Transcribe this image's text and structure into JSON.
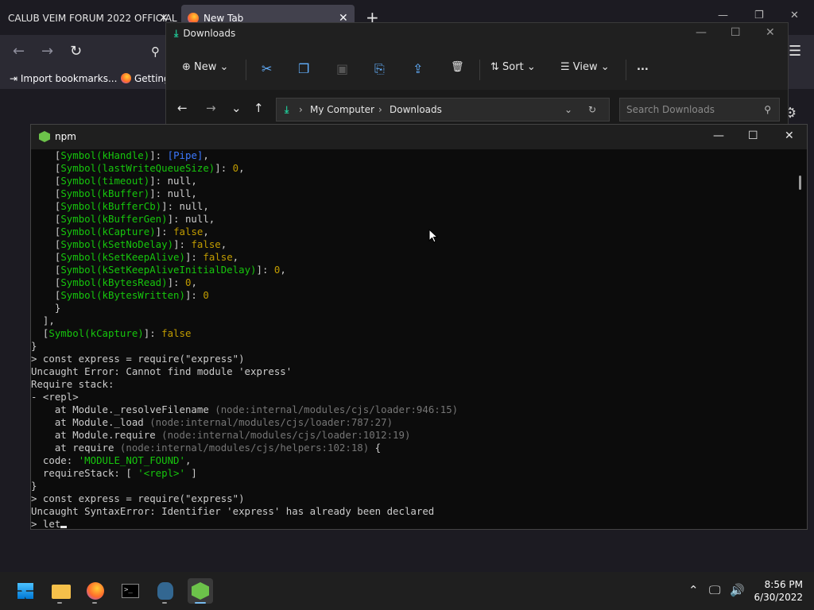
{
  "browser": {
    "tabs": [
      {
        "label": "CALUB VEIM FORUM 2022 OFFICIAL",
        "close": "✕"
      },
      {
        "label": "New Tab",
        "close": "✕"
      }
    ],
    "new_tab": "+",
    "bookmarks": [
      {
        "label": "Import bookmarks...",
        "icon": "import-icon"
      },
      {
        "label": "Getting",
        "icon": "firefox-icon"
      }
    ]
  },
  "explorer": {
    "title": "Downloads",
    "toolbar": {
      "new_label": "New",
      "sort_label": "Sort",
      "view_label": "View",
      "more_label": "..."
    },
    "breadcrumb": [
      "My Computer",
      "Downloads"
    ],
    "search_placeholder": "Search Downloads"
  },
  "terminal": {
    "title": "npm",
    "lines": [
      [
        [
          "    [",
          ""
        ],
        [
          "Symbol(kHandle)",
          "g"
        ],
        [
          "]: ",
          ""
        ],
        [
          "[Pipe]",
          "b"
        ],
        [
          ",",
          ""
        ]
      ],
      [
        [
          "    [",
          ""
        ],
        [
          "Symbol(lastWriteQueueSize)",
          "g"
        ],
        [
          "]: ",
          ""
        ],
        [
          "0",
          "y"
        ],
        [
          ",",
          ""
        ]
      ],
      [
        [
          "    [",
          ""
        ],
        [
          "Symbol(timeout)",
          "g"
        ],
        [
          "]: null,",
          ""
        ]
      ],
      [
        [
          "    [",
          ""
        ],
        [
          "Symbol(kBuffer)",
          "g"
        ],
        [
          "]: null,",
          ""
        ]
      ],
      [
        [
          "    [",
          ""
        ],
        [
          "Symbol(kBufferCb)",
          "g"
        ],
        [
          "]: null,",
          ""
        ]
      ],
      [
        [
          "    [",
          ""
        ],
        [
          "Symbol(kBufferGen)",
          "g"
        ],
        [
          "]: null,",
          ""
        ]
      ],
      [
        [
          "    [",
          ""
        ],
        [
          "Symbol(kCapture)",
          "g"
        ],
        [
          "]: ",
          ""
        ],
        [
          "false",
          "y"
        ],
        [
          ",",
          ""
        ]
      ],
      [
        [
          "    [",
          ""
        ],
        [
          "Symbol(kSetNoDelay)",
          "g"
        ],
        [
          "]: ",
          ""
        ],
        [
          "false",
          "y"
        ],
        [
          ",",
          ""
        ]
      ],
      [
        [
          "    [",
          ""
        ],
        [
          "Symbol(kSetKeepAlive)",
          "g"
        ],
        [
          "]: ",
          ""
        ],
        [
          "false",
          "y"
        ],
        [
          ",",
          ""
        ]
      ],
      [
        [
          "    [",
          ""
        ],
        [
          "Symbol(kSetKeepAliveInitialDelay)",
          "g"
        ],
        [
          "]: ",
          ""
        ],
        [
          "0",
          "y"
        ],
        [
          ",",
          ""
        ]
      ],
      [
        [
          "    [",
          ""
        ],
        [
          "Symbol(kBytesRead)",
          "g"
        ],
        [
          "]: ",
          ""
        ],
        [
          "0",
          "y"
        ],
        [
          ",",
          ""
        ]
      ],
      [
        [
          "    [",
          ""
        ],
        [
          "Symbol(kBytesWritten)",
          "g"
        ],
        [
          "]: ",
          ""
        ],
        [
          "0",
          "y"
        ]
      ],
      [
        [
          "    }",
          ""
        ]
      ],
      [
        [
          "  ],",
          ""
        ]
      ],
      [
        [
          "  [",
          ""
        ],
        [
          "Symbol(kCapture)",
          "g"
        ],
        [
          "]: ",
          ""
        ],
        [
          "false",
          "y"
        ]
      ],
      [
        [
          "}",
          ""
        ]
      ],
      [
        [
          "> const express = require(\"express\")",
          ""
        ]
      ],
      [
        [
          "Uncaught Error: Cannot find module 'express'",
          ""
        ]
      ],
      [
        [
          "Require stack:",
          ""
        ]
      ],
      [
        [
          "- <repl>",
          ""
        ]
      ],
      [
        [
          "    at Module._resolveFilename ",
          ""
        ],
        [
          "(node:internal/modules/cjs/loader:946:15)",
          "gr"
        ]
      ],
      [
        [
          "    at Module._load ",
          ""
        ],
        [
          "(node:internal/modules/cjs/loader:787:27)",
          "gr"
        ]
      ],
      [
        [
          "    at Module.require ",
          ""
        ],
        [
          "(node:internal/modules/cjs/loader:1012:19)",
          "gr"
        ]
      ],
      [
        [
          "    at require ",
          ""
        ],
        [
          "(node:internal/modules/cjs/helpers:102:18)",
          "gr"
        ],
        [
          " {",
          ""
        ]
      ],
      [
        [
          "  code: ",
          ""
        ],
        [
          "'MODULE_NOT_FOUND'",
          "g"
        ],
        [
          ",",
          ""
        ]
      ],
      [
        [
          "  requireStack: [ ",
          ""
        ],
        [
          "'<repl>'",
          "g"
        ],
        [
          " ]",
          ""
        ]
      ],
      [
        [
          "}",
          ""
        ]
      ],
      [
        [
          "> const express = require(\"express\")",
          ""
        ]
      ],
      [
        [
          "Uncaught SyntaxError: Identifier 'express' has already been declared",
          ""
        ]
      ],
      [
        [
          "> let",
          ""
        ]
      ]
    ]
  },
  "taskbar": {
    "clock_time": "8:56 PM",
    "clock_date": "6/30/2022"
  }
}
